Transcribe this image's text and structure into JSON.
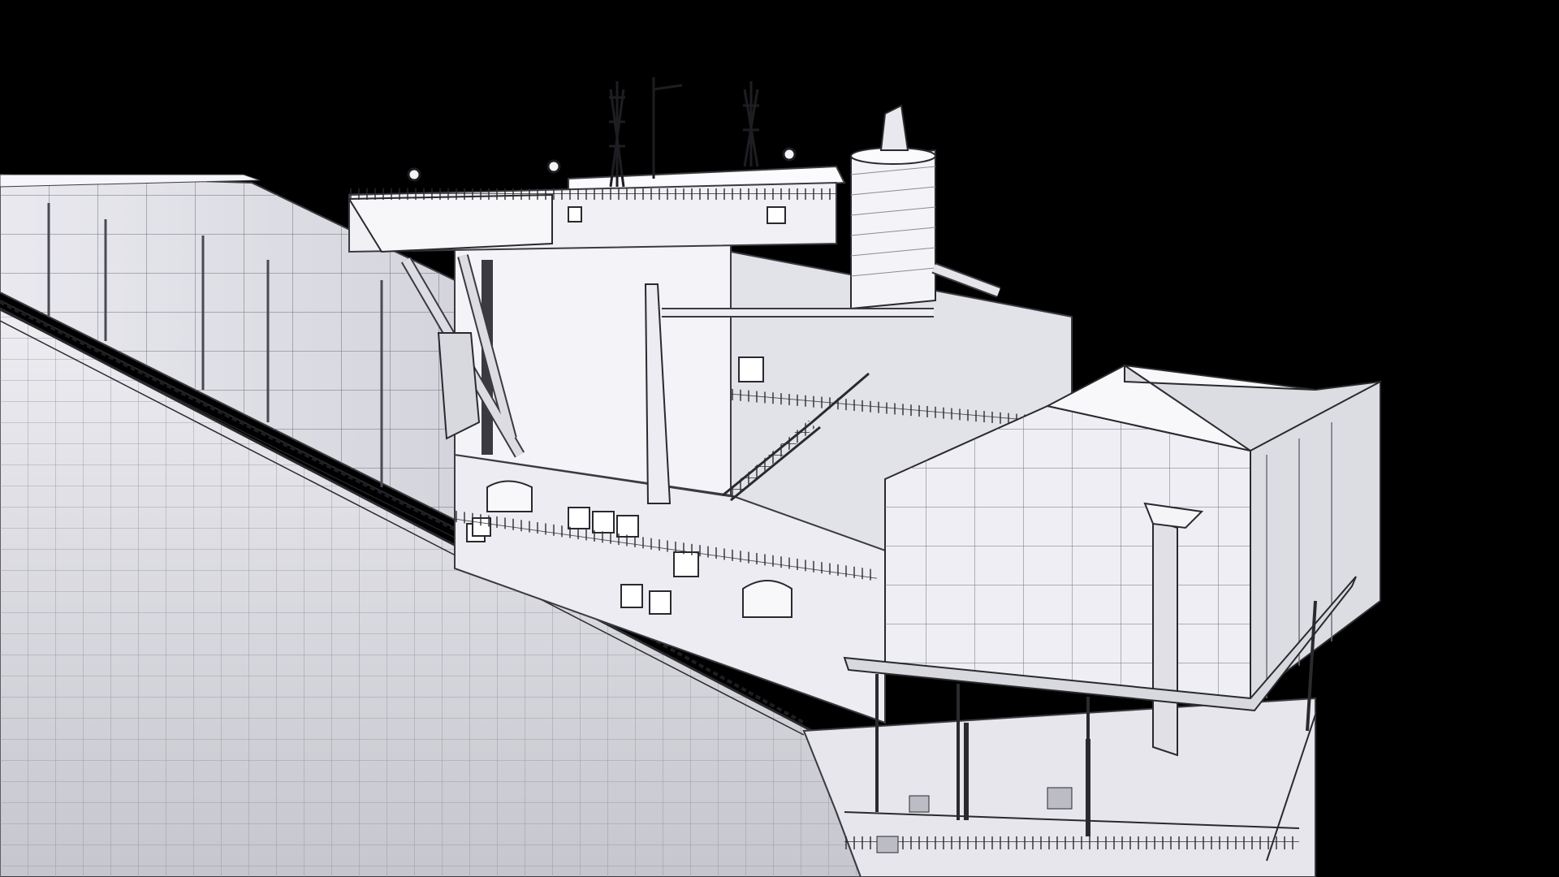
{
  "scene": {
    "subject": "container-ship-wireframe-render",
    "background_color": "#000000",
    "model_fill_color": "#f2f2f6",
    "model_shade_color": "#c9c9d1",
    "wire_color": "#2a2a2e"
  }
}
